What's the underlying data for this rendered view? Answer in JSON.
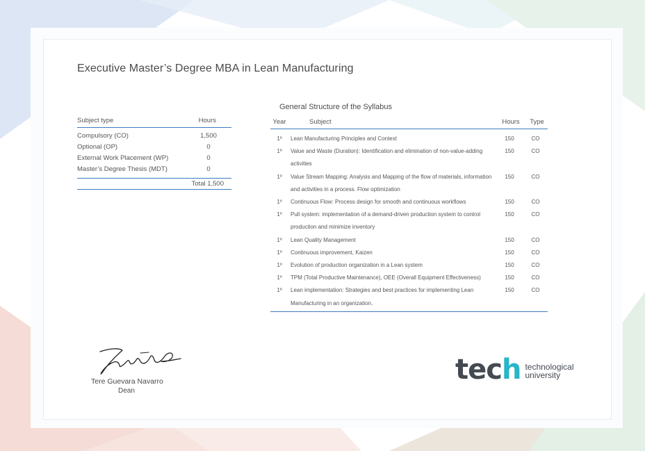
{
  "title": "Executive Master’s Degree MBA in Lean Manufacturing",
  "summary": {
    "header": {
      "type": "Subject type",
      "hours": "Hours"
    },
    "rows": [
      {
        "type": "Compulsory (CO)",
        "hours": "1,500"
      },
      {
        "type": "Optional (OP)",
        "hours": "0"
      },
      {
        "type": "External Work Placement (WP)",
        "hours": "0"
      },
      {
        "type": "Master’s Degree Thesis (MDT)",
        "hours": "0"
      }
    ],
    "total": "Total 1,500"
  },
  "syllabus": {
    "title": "General Structure of the Syllabus",
    "header": {
      "year": "Year",
      "subject": "Subject",
      "hours": "Hours",
      "type": "Type"
    },
    "rows": [
      {
        "year": "1º",
        "subject": "Lean Manufacturing Principles and Context",
        "hours": "150",
        "type": "CO"
      },
      {
        "year": "1º",
        "subject": "Value and Waste (Duration): Identification and elimination of non-value-adding activities",
        "hours": "150",
        "type": "CO"
      },
      {
        "year": "1º",
        "subject": "Value Stream Mapping: Analysis and Mapping of the flow of materials, information and activities in a process. Flow optimization",
        "hours": "150",
        "type": "CO"
      },
      {
        "year": "1º",
        "subject": "Continuous Flow: Process design for smooth and continuous workflows",
        "hours": "150",
        "type": "CO"
      },
      {
        "year": "1º",
        "subject": "Pull system: implementation of a demand-driven production system to control production and minimize inventory",
        "hours": "150",
        "type": "CO"
      },
      {
        "year": "1º",
        "subject": "Lean Quality Management",
        "hours": "150",
        "type": "CO"
      },
      {
        "year": "1º",
        "subject": "Continuous improvement, Kaizen",
        "hours": "150",
        "type": "CO"
      },
      {
        "year": "1º",
        "subject": "Evolution of production organization in a Lean system",
        "hours": "150",
        "type": "CO"
      },
      {
        "year": "1º",
        "subject": "TPM (Total Productive Maintenance), OEE (Overall Equipment Effectiveness)",
        "hours": "150",
        "type": "CO"
      },
      {
        "year": "1º",
        "subject": "Lean implementation: Strategies and best practices for implementing Lean Manufacturing in an organization.",
        "hours": "150",
        "type": "CO"
      }
    ]
  },
  "signatory": {
    "name": "Tere Guevara Navarro",
    "role": "Dean"
  },
  "logo": {
    "word_start": "tec",
    "word_end": "h",
    "line1": "technological",
    "line2": "university"
  },
  "colors": {
    "accent": "#3b7bbf",
    "logo_teal": "#27b5c8",
    "text": "#555555"
  }
}
